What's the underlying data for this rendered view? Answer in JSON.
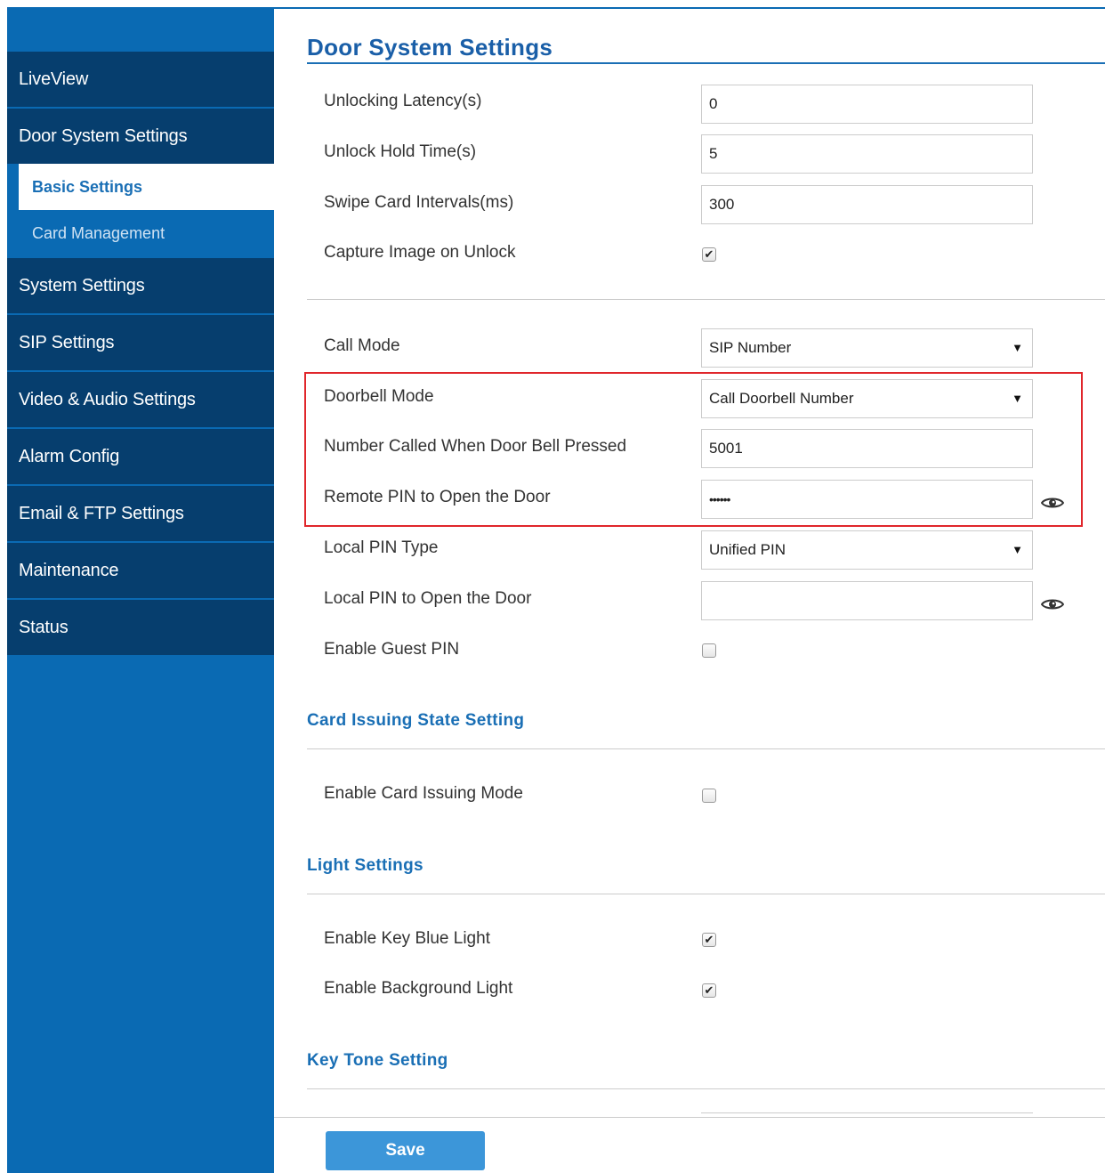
{
  "sidebar": {
    "items": [
      {
        "label": "LiveView"
      },
      {
        "label": "Door System Settings"
      },
      {
        "label": "Basic Settings"
      },
      {
        "label": "Card Management"
      },
      {
        "label": "System Settings"
      },
      {
        "label": "SIP Settings"
      },
      {
        "label": "Video & Audio Settings"
      },
      {
        "label": "Alarm Config"
      },
      {
        "label": "Email & FTP Settings"
      },
      {
        "label": "Maintenance"
      },
      {
        "label": "Status"
      }
    ]
  },
  "page": {
    "title": "Door System Settings"
  },
  "door": {
    "unlocking_latency": {
      "label": "Unlocking Latency(s)",
      "value": "0"
    },
    "unlock_hold_time": {
      "label": "Unlock Hold Time(s)",
      "value": "5"
    },
    "swipe_card_intervals": {
      "label": "Swipe Card Intervals(ms)",
      "value": "300"
    },
    "capture_image": {
      "label": "Capture Image on Unlock",
      "checked": true,
      "mark": "✔"
    },
    "call_mode": {
      "label": "Call Mode",
      "value": "SIP Number",
      "arrow": "▼"
    },
    "doorbell_mode": {
      "label": "Doorbell Mode",
      "value": "Call Doorbell Number",
      "arrow": "▼"
    },
    "number_called": {
      "label": "Number Called When Door Bell Pressed",
      "value": "5001"
    },
    "remote_pin": {
      "label": "Remote PIN to Open the Door",
      "value": "••••••"
    },
    "local_pin_type": {
      "label": "Local PIN Type",
      "value": "Unified PIN",
      "arrow": "▼"
    },
    "local_pin": {
      "label": "Local PIN to Open the Door",
      "value": ""
    },
    "enable_guest_pin": {
      "label": "Enable Guest PIN",
      "checked": false
    }
  },
  "card_issuing": {
    "title": "Card Issuing State Setting",
    "enable_card_issuing": {
      "label": "Enable Card Issuing Mode",
      "checked": false
    }
  },
  "light": {
    "title": "Light Settings",
    "key_blue_light": {
      "label": "Enable Key Blue Light",
      "checked": true,
      "mark": "✔"
    },
    "background_light": {
      "label": "Enable Background Light",
      "checked": true,
      "mark": "✔"
    }
  },
  "key_tone": {
    "title": "Key Tone Setting"
  },
  "footer": {
    "save_label": "Save"
  },
  "colors": {
    "sidebar_dark": "#063e6e",
    "sidebar_blue": "#0a6ab3",
    "accent": "#1a6fb5",
    "highlight": "#e0262b",
    "save": "#3c96d9"
  },
  "icons": {
    "eye": "eye-icon",
    "dropdown": "chevron-down-icon",
    "check": "check-icon"
  }
}
